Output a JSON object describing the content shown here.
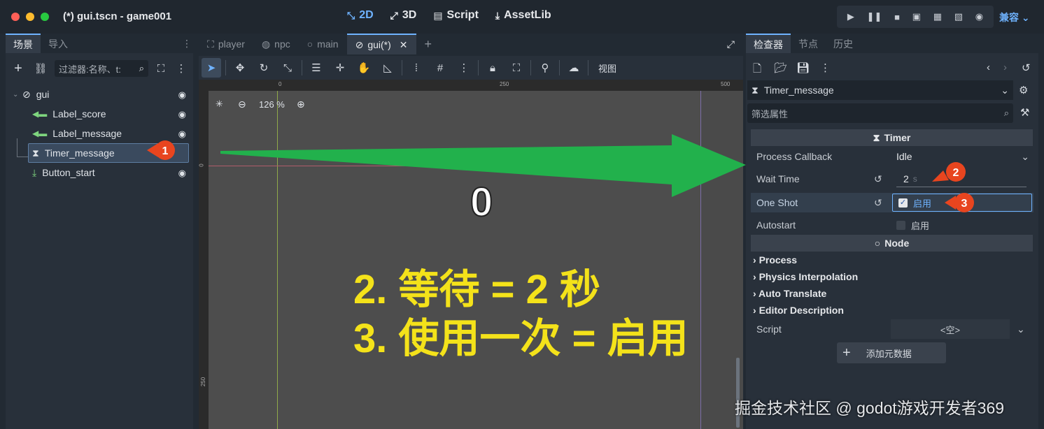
{
  "window": {
    "title": "(*) gui.tscn - game001"
  },
  "modes": [
    {
      "label": "2D",
      "icon": "2d-icon"
    },
    {
      "label": "3D",
      "icon": "3d-icon"
    },
    {
      "label": "Script",
      "icon": "script-icon"
    },
    {
      "label": "AssetLib",
      "icon": "assetlib-icon"
    }
  ],
  "renderer": "兼容",
  "scene_dock": {
    "tabs": [
      "场景",
      "导入"
    ],
    "filter_placeholder": "过滤器:名称、t:",
    "tree": [
      {
        "label": "gui",
        "icon": "control-icon"
      },
      {
        "label": "Label_score",
        "icon": "label-icon"
      },
      {
        "label": "Label_message",
        "icon": "label-icon"
      },
      {
        "label": "Timer_message",
        "icon": "timer-icon"
      },
      {
        "label": "Button_start",
        "icon": "button-icon"
      }
    ]
  },
  "editor_tabs": [
    {
      "label": "player"
    },
    {
      "label": "npc"
    },
    {
      "label": "main"
    },
    {
      "label": "gui(*)"
    }
  ],
  "viewport": {
    "view_menu": "视图",
    "zoom": "126 %",
    "ruler_marks": [
      "0",
      "250",
      "500"
    ],
    "vruler_marks": [
      "0",
      "250"
    ],
    "score_text": "0"
  },
  "overlay": {
    "line1": "2. 等待 = 2 秒",
    "line2": "3. 使用一次 =  启用"
  },
  "badges": [
    "1",
    "2",
    "3"
  ],
  "inspector": {
    "tabs": [
      "检查器",
      "节点",
      "历史"
    ],
    "node_name": "Timer_message",
    "filter_placeholder": "筛选属性",
    "section_timer": "Timer",
    "props": [
      {
        "label": "Process Callback",
        "value": "Idle"
      },
      {
        "label": "Wait Time",
        "value": "2",
        "unit": "s"
      },
      {
        "label": "One Shot",
        "value": "启用",
        "checked": true
      },
      {
        "label": "Autostart",
        "value": "启用",
        "checked": false
      }
    ],
    "section_node": "Node",
    "groups": [
      "Process",
      "Physics Interpolation",
      "Auto Translate",
      "Editor Description"
    ],
    "script_label": "Script",
    "script_value": "<空>",
    "add_meta": "添加元数据"
  },
  "watermark": "掘金技术社区 @ godot游戏开发者369",
  "colors": {
    "accent": "#6fb3ff",
    "badge": "#e8451f",
    "arrow": "#22b14c",
    "overlay_text": "#f4e21a"
  }
}
